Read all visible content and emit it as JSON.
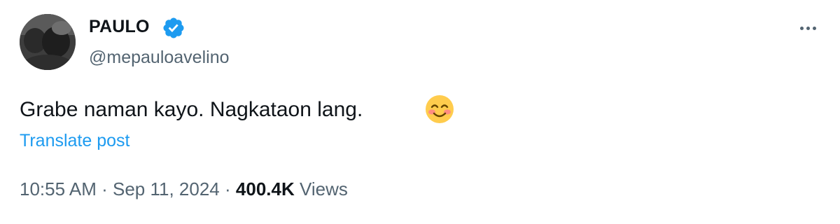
{
  "author": {
    "display_name": "PAULO",
    "handle": "@mepauloavelino",
    "verified": true,
    "verified_color": "#1d9bf0",
    "avatar": "user-avatar-photo"
  },
  "post": {
    "text": "Grabe naman kayo. Nagkataon lang.",
    "emoji": "smiling-face-with-smiling-eyes",
    "translate_label": "Translate post"
  },
  "meta": {
    "time": "10:55 AM",
    "separator": "·",
    "date": "Sep 11, 2024",
    "views_count": "400.4K",
    "views_label": "Views"
  },
  "more_menu": {
    "icon": "more-horizontal-icon"
  },
  "colors": {
    "primary_text": "#0f1419",
    "secondary_text": "#536471",
    "link": "#1d9bf0"
  }
}
